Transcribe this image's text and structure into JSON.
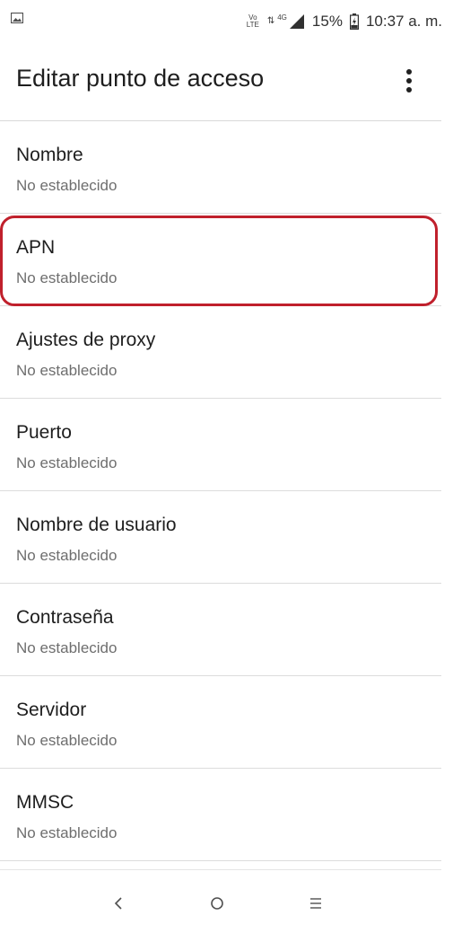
{
  "status_bar": {
    "volte_top": "Vo",
    "volte_bottom": "LTE",
    "network": "4G",
    "battery": "15%",
    "time": "10:37 a. m."
  },
  "app_bar": {
    "title": "Editar punto de acceso",
    "overflow_icon": "more-vert-icon"
  },
  "list": {
    "items": [
      {
        "title": "Nombre",
        "value": "No establecido"
      },
      {
        "title": "APN",
        "value": "No establecido",
        "highlighted": true
      },
      {
        "title": "Ajustes de proxy",
        "value": "No establecido"
      },
      {
        "title": "Puerto",
        "value": "No establecido"
      },
      {
        "title": "Nombre de usuario",
        "value": "No establecido"
      },
      {
        "title": "Contraseña",
        "value": "No establecido"
      },
      {
        "title": "Servidor",
        "value": "No establecido"
      },
      {
        "title": "MMSC",
        "value": "No establecido"
      }
    ]
  },
  "nav_bar": {
    "back_icon": "back-chevron-icon",
    "home_icon": "home-circle-icon",
    "menu_icon": "menu-lines-icon"
  },
  "colors": {
    "highlight": "#c0202c",
    "divider": "#dcdcdc",
    "subtitle": "#6e6e6e"
  }
}
